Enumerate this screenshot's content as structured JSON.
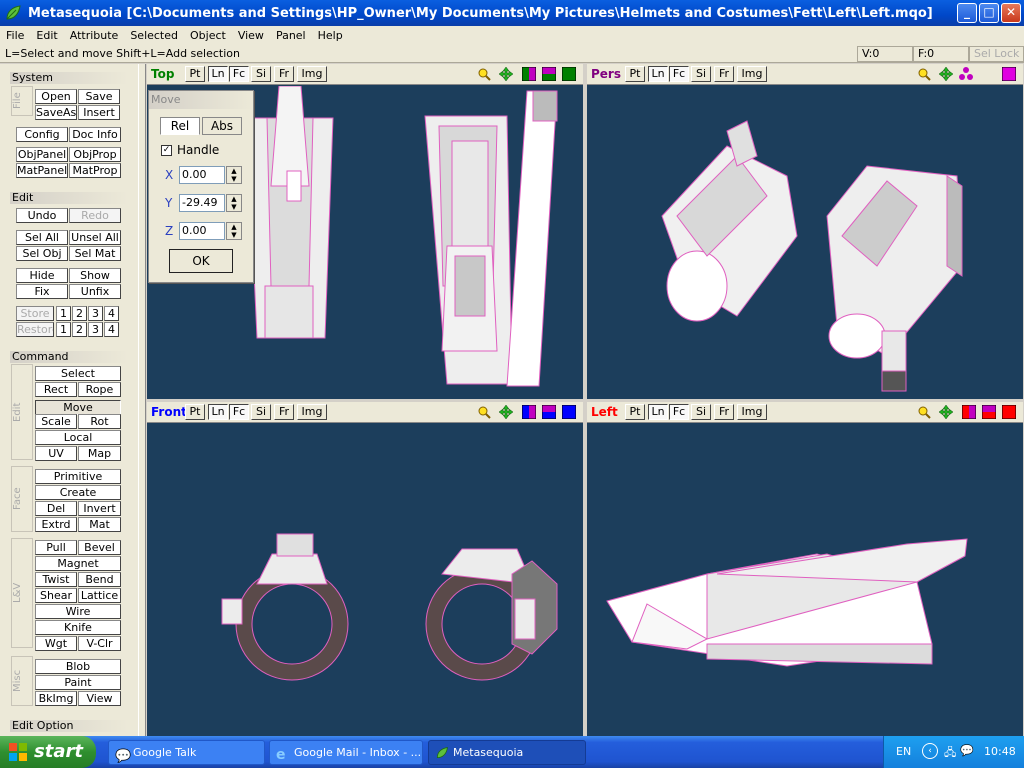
{
  "window": {
    "title": "Metasequoia [C:\\Documents and Settings\\HP_Owner\\My Documents\\My Pictures\\Helmets and Costumes\\Fett\\Left\\Left.mqo]",
    "minimize": "_",
    "maximize": "□",
    "close": "✕"
  },
  "menu": [
    "File",
    "Edit",
    "Attribute",
    "Selected",
    "Object",
    "View",
    "Panel",
    "Help"
  ],
  "hint": {
    "text": "L=Select and move  Shift+L=Add selection",
    "v": "V:0",
    "f": "F:0",
    "sel_lock": "Sel Lock"
  },
  "panel": {
    "system": {
      "head": "System",
      "tag": "File",
      "buttons": [
        "Open",
        "Save",
        "SaveAs",
        "Insert",
        "Config",
        "Doc Info",
        "ObjPanel",
        "ObjProp",
        "MatPanel",
        "MatProp"
      ]
    },
    "edit": {
      "head": "Edit",
      "buttons": [
        "Undo",
        "Redo",
        "Sel All",
        "Unsel All",
        "Sel Obj",
        "Sel Mat",
        "Hide",
        "Show",
        "Fix",
        "Unfix",
        "Store",
        "Restore",
        "1",
        "2",
        "3",
        "4",
        "1",
        "2",
        "3",
        "4"
      ]
    },
    "command": {
      "head": "Command",
      "edit_tag": "Edit",
      "edit_buttons": [
        "Select",
        "Rect",
        "Rope",
        "Move",
        "Scale",
        "Rot",
        "Local",
        "UV",
        "Map"
      ],
      "face_tag": "Face",
      "face_buttons": [
        "Primitive",
        "Create",
        "Del",
        "Invert",
        "Extrd",
        "Mat"
      ],
      "lv_tag": "L&V",
      "lv_buttons": [
        "Pull",
        "Bevel",
        "Magnet",
        "Twist",
        "Bend",
        "Shear",
        "Lattice",
        "Wire",
        "Knife",
        "Wgt",
        "V-Clr"
      ],
      "misc_tag": "Misc",
      "misc_buttons": [
        "Blob",
        "Paint",
        "BkImg",
        "View"
      ]
    },
    "edit_option": {
      "head": "Edit Option"
    }
  },
  "viewport_buttons": [
    "Pt",
    "Ln",
    "Fc",
    "Si",
    "Fr",
    "Img"
  ],
  "viewports": {
    "top": {
      "name": "Top",
      "color": "#008000"
    },
    "pers": {
      "name": "Pers",
      "color": "#800080"
    },
    "front": {
      "name": "Front",
      "color": "#0000ff"
    },
    "left": {
      "name": "Left",
      "color": "#ff0000"
    }
  },
  "move_dialog": {
    "title": "Move",
    "tab_rel": "Rel",
    "tab_abs": "Abs",
    "handle_label": "Handle",
    "handle_checked": true,
    "x_label": "X",
    "x_value": "0.00",
    "y_label": "Y",
    "y_value": "-29.49",
    "z_label": "Z",
    "z_value": "0.00",
    "ok": "OK"
  },
  "taskbar": {
    "start": "start",
    "tasks": [
      "Google Talk",
      "Google Mail - Inbox - ...",
      "Metasequoia"
    ],
    "lang": "EN",
    "clock": "10:48"
  }
}
